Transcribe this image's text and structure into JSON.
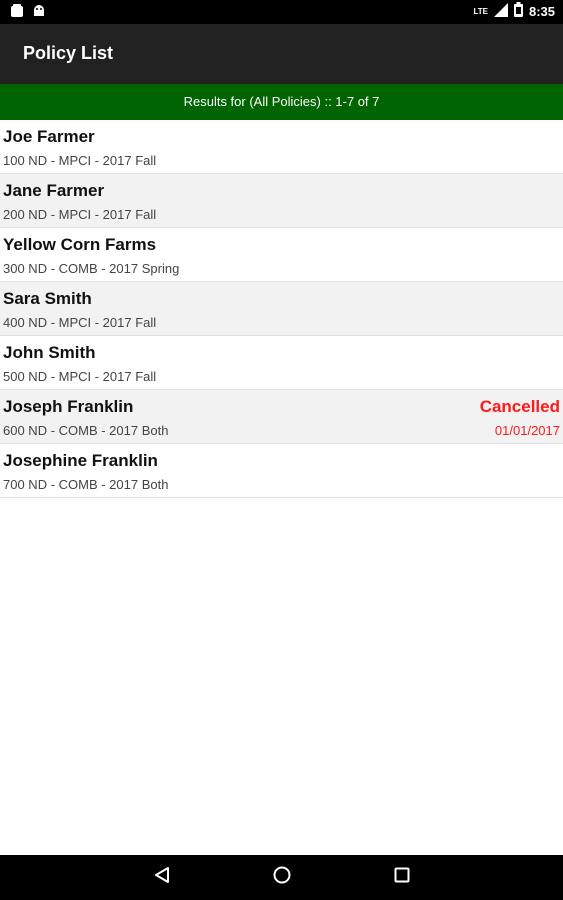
{
  "status_bar": {
    "time": "8:35",
    "network": "LTE",
    "icons": [
      "notification-icon",
      "android-icon",
      "signal-icon",
      "battery-icon"
    ]
  },
  "app_bar": {
    "title": "Policy List"
  },
  "results_bar": {
    "text": "Results for (All Policies) :: 1-7 of 7"
  },
  "policies": [
    {
      "name": "Joe Farmer",
      "detail": "100 ND - MPCI - 2017 Fall",
      "status": "",
      "date": ""
    },
    {
      "name": "Jane Farmer",
      "detail": "200 ND - MPCI - 2017 Fall",
      "status": "",
      "date": ""
    },
    {
      "name": "Yellow Corn Farms",
      "detail": "300 ND - COMB - 2017 Spring",
      "status": "",
      "date": ""
    },
    {
      "name": "Sara Smith",
      "detail": "400 ND - MPCI - 2017 Fall",
      "status": "",
      "date": ""
    },
    {
      "name": "John Smith",
      "detail": "500 ND - MPCI - 2017 Fall",
      "status": "",
      "date": ""
    },
    {
      "name": "Joseph Franklin",
      "detail": "600 ND - COMB - 2017 Both",
      "status": "Cancelled",
      "date": "01/01/2017"
    },
    {
      "name": "Josephine Franklin",
      "detail": "700 ND - COMB - 2017 Both",
      "status": "",
      "date": ""
    }
  ],
  "colors": {
    "app_bar": "#212121",
    "results_bar": "#006400",
    "alt_row": "#f2f2f2",
    "cancelled": "#ff1a1a"
  },
  "nav_bar": {
    "icons": [
      "back-icon",
      "home-icon",
      "recents-icon"
    ]
  }
}
